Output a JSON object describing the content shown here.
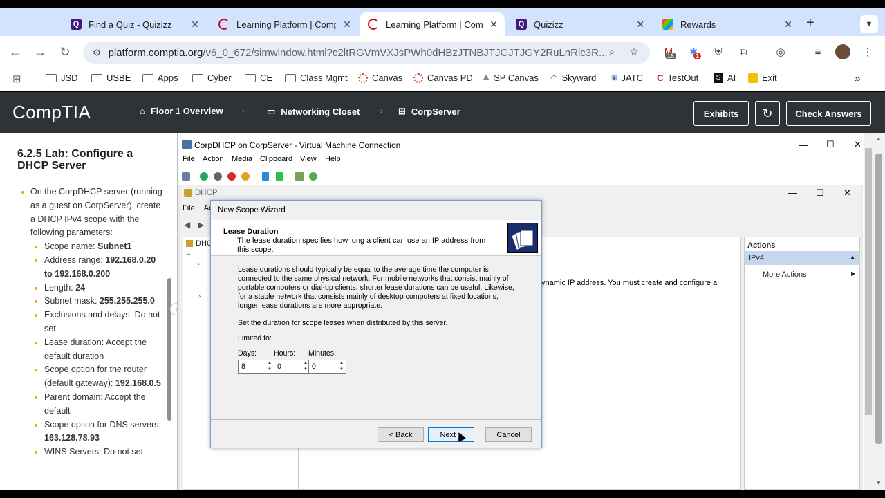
{
  "browser": {
    "tabs": [
      {
        "title": "Find a Quiz - Quizizz",
        "icon": "quizizz-icon",
        "active": false
      },
      {
        "title": "Learning Platform | Comp",
        "icon": "comptia-icon",
        "active": false
      },
      {
        "title": "Learning Platform | Comp",
        "icon": "comptia-icon",
        "active": true
      },
      {
        "title": "Quizizz",
        "icon": "quizizz-icon",
        "active": false
      },
      {
        "title": "Rewards",
        "icon": "rewards-icon",
        "active": false
      }
    ],
    "new_tab_label": "+",
    "url_host": "platform.comptia.org",
    "url_path": "/v6_0_672/simwindow.html?c2ltRGVmVXJsPWh0dHBzJTNBJTJGJTJGY2RuLnRlc3R...",
    "ext_badges": [
      "16",
      "1"
    ],
    "bookmarks": [
      "JSD",
      "USBE",
      "Apps",
      "Cyber",
      "CE",
      "Class Mgmt",
      "Canvas",
      "Canvas PD",
      "SP Canvas",
      "Skyward",
      "JATC",
      "TestOut",
      "AI",
      "Exit"
    ],
    "more_bookmarks": "»"
  },
  "header": {
    "logo": "CompTIA",
    "crumbs": [
      "Floor 1 Overview",
      "Networking Closet",
      "CorpServer"
    ],
    "exhibits": "Exhibits",
    "check_answers": "Check Answers"
  },
  "lab": {
    "title": "6.2.5 Lab: Configure a DHCP Server",
    "intro": "On the CorpDHCP server (running as a guest on CorpServer), create a DHCP IPv4 scope with the following parameters:",
    "params": [
      {
        "label": "Scope name: ",
        "value": "Subnet1"
      },
      {
        "label": "Address range: ",
        "value": "192.168.0.20 to 192.168.0.200"
      },
      {
        "label": "Length: ",
        "value": "24"
      },
      {
        "label": "Subnet mask: ",
        "value": "255.255.255.0"
      },
      {
        "label": "Exclusions and delays: Do not set",
        "value": ""
      },
      {
        "label": "Lease duration: Accept the default duration",
        "value": ""
      },
      {
        "label": "Scope option for the router (default gateway): ",
        "value": "192.168.0.5"
      },
      {
        "label": "Parent domain: Accept the default",
        "value": ""
      },
      {
        "label": "Scope option for DNS servers: ",
        "value": "163.128.78.93"
      },
      {
        "label": "WINS Servers: Do not set",
        "value": ""
      }
    ]
  },
  "vm": {
    "title": "CorpDHCP on CorpServer - Virtual Machine Connection",
    "menu": [
      "File",
      "Action",
      "Media",
      "Clipboard",
      "View",
      "Help"
    ]
  },
  "dhcp": {
    "title": "DHCP",
    "menu": [
      "File",
      "Ac"
    ],
    "tree_root": "DHCI",
    "center_text": "ynamic IP address. You must create and configure a",
    "actions_header": "Actions",
    "actions_group": "IPv4",
    "more_actions": "More Actions"
  },
  "wizard": {
    "title": "New Scope Wizard",
    "heading": "Lease Duration",
    "subheading": "The lease duration specifies how long a client can use an IP address from this scope.",
    "body": "Lease durations should typically be equal to the average time the computer is connected to the same physical network. For mobile networks that consist mainly of portable computers or dial-up clients, shorter lease durations can be useful. Likewise, for a stable network that consists mainly of desktop computers at fixed locations, longer lease durations are more appropriate.",
    "set_text": "Set the duration for scope leases when distributed by this server.",
    "limited_to": "Limited to:",
    "days_label": "Days:",
    "hours_label": "Hours:",
    "minutes_label": "Minutes:",
    "days": "8",
    "hours": "0",
    "minutes": "0",
    "back": "< Back",
    "next": "Next >",
    "cancel": "Cancel"
  },
  "colors": {
    "tabbar": "#d3e3fd",
    "header": "#2f3338",
    "bullet": "#e7b000"
  }
}
